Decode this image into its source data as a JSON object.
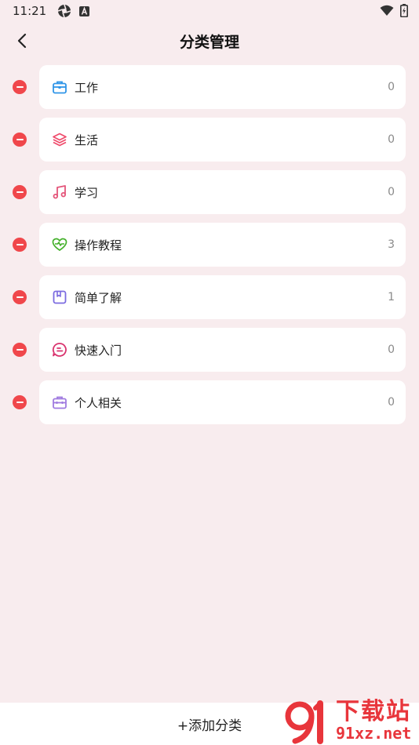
{
  "status_bar": {
    "time": "11:21",
    "icons_left": [
      "settings-aperture-icon",
      "text-a-icon"
    ],
    "icons_right": [
      "wifi-icon",
      "battery-charging-icon"
    ]
  },
  "header": {
    "title": "分类管理",
    "back_icon": "chevron-left-icon"
  },
  "categories": [
    {
      "label": "工作",
      "count": "0",
      "icon": "briefcase-icon",
      "color": "#2f95e8"
    },
    {
      "label": "生活",
      "count": "0",
      "icon": "layers-icon",
      "color": "#ef4a6b"
    },
    {
      "label": "学习",
      "count": "0",
      "icon": "music-note-icon",
      "color": "#e4557a"
    },
    {
      "label": "操作教程",
      "count": "3",
      "icon": "heart-pulse-icon",
      "color": "#43b02a"
    },
    {
      "label": "简单了解",
      "count": "1",
      "icon": "bookmark-square-icon",
      "color": "#7b6be0"
    },
    {
      "label": "快速入门",
      "count": "0",
      "icon": "chat-bubble-icon",
      "color": "#d9336e"
    },
    {
      "label": "个人相关",
      "count": "0",
      "icon": "toolbox-icon",
      "color": "#a07be0"
    }
  ],
  "bottom": {
    "add_label": "+添加分类"
  },
  "watermark": {
    "cn": "下载站",
    "en": "91xz.net",
    "color": "#e8353b"
  },
  "colors": {
    "background": "#f8ecee",
    "delete": "#f0474b"
  }
}
